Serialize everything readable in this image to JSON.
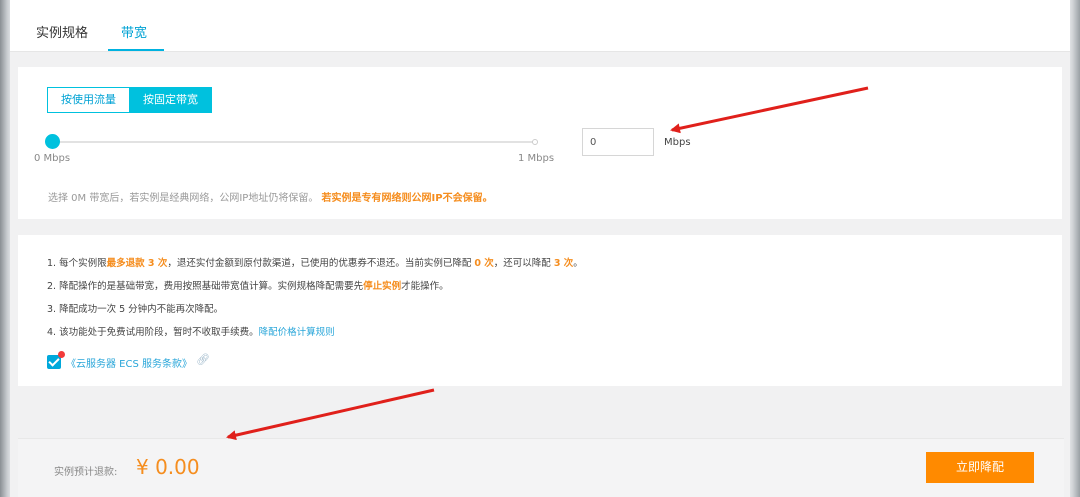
{
  "tabs": [
    {
      "label": "实例规格",
      "active": false
    },
    {
      "label": "带宽",
      "active": true
    }
  ],
  "bandwidth": {
    "mode_options": [
      {
        "label": "按使用流量",
        "selected": false
      },
      {
        "label": "按固定带宽",
        "selected": true
      }
    ],
    "slider": {
      "value": 0,
      "min_label": "0 Mbps",
      "max_label": "1 Mbps"
    },
    "input_value": "0",
    "unit": "Mbps",
    "note": "选择 0M 带宽后，若实例是经典网络，公网IP地址仍将保留。",
    "note_highlight": "若实例是专有网络则公网IP不会保留。"
  },
  "rules": [
    {
      "parts": [
        {
          "t": "1. 每个实例限",
          "s": ""
        },
        {
          "t": "最多退款 3 次",
          "s": "hl"
        },
        {
          "t": "，退还实付金额到原付款渠道，已使用的优惠券不退还。当前实例已降配 ",
          "s": ""
        },
        {
          "t": "0 次",
          "s": "hl"
        },
        {
          "t": "，还可以降配 ",
          "s": ""
        },
        {
          "t": "3 次",
          "s": "hl"
        },
        {
          "t": "。",
          "s": ""
        }
      ]
    },
    {
      "parts": [
        {
          "t": "2. 降配操作的是基础带宽，费用按照基础带宽值计算。实例规格降配需要先",
          "s": ""
        },
        {
          "t": "停止实例",
          "s": "hl"
        },
        {
          "t": "才能操作。",
          "s": ""
        }
      ]
    },
    {
      "parts": [
        {
          "t": "3. 降配成功一次 5 分钟内不能再次降配。",
          "s": ""
        }
      ]
    },
    {
      "parts": [
        {
          "t": "4. 该功能处于免费试用阶段，暂时不收取手续费。",
          "s": ""
        },
        {
          "t": "降配价格计算规则",
          "s": "link"
        }
      ]
    }
  ],
  "agreement": {
    "checked": true,
    "label": "《云服务器 ECS 服务条款》",
    "icon": "link-icon"
  },
  "footer": {
    "refund_label": "实例预计退款:",
    "refund_value": "¥ 0.00",
    "button_label": "立即降配"
  },
  "colors": {
    "accent": "#00c1de",
    "highlight": "#f58d1e",
    "button": "#ff8a00",
    "link": "#29a6d9",
    "arrow": "#e0201b"
  }
}
